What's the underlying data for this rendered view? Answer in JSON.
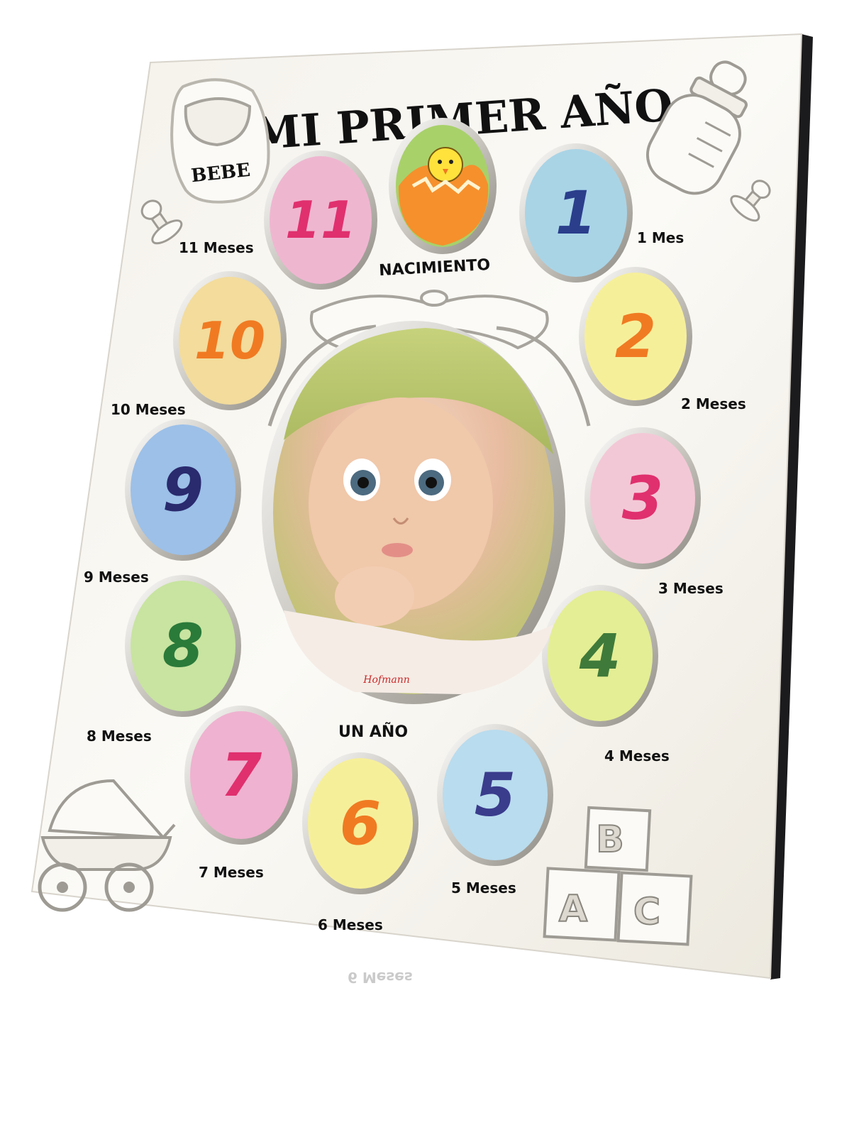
{
  "frame": {
    "title": "MI PRIMER AÑO",
    "bib_text": "BEBE",
    "center_top_label": "NACIMIENTO",
    "center_bottom_label": "UN AÑO",
    "brand": "Hofmann",
    "reflection_text": "6 Meses"
  },
  "months": [
    {
      "number": "1",
      "caption": "1 Mes",
      "bg": "#a9d4e6",
      "fg": "#2a3e8c"
    },
    {
      "number": "2",
      "caption": "2 Meses",
      "bg": "#f6ef9a",
      "fg": "#f07a22"
    },
    {
      "number": "3",
      "caption": "3 Meses",
      "bg": "#f3c8d6",
      "fg": "#e0306e"
    },
    {
      "number": "4",
      "caption": "4 Meses",
      "bg": "#e4ee94",
      "fg": "#3f7a3a"
    },
    {
      "number": "5",
      "caption": "5 Meses",
      "bg": "#b9dcee",
      "fg": "#3a3c8c"
    },
    {
      "number": "6",
      "caption": "6 Meses",
      "bg": "#f6ef9a",
      "fg": "#f07a22"
    },
    {
      "number": "7",
      "caption": "7 Meses",
      "bg": "#efb2d0",
      "fg": "#e0306e"
    },
    {
      "number": "8",
      "caption": "8 Meses",
      "bg": "#c8e4a0",
      "fg": "#2a7a3a"
    },
    {
      "number": "9",
      "caption": "9 Meses",
      "bg": "#9cc0e8",
      "fg": "#2a2a6e"
    },
    {
      "number": "10",
      "caption": "10 Meses",
      "bg": "#f3dc9c",
      "fg": "#f07a22"
    },
    {
      "number": "11",
      "caption": "11 Meses",
      "bg": "#efb6d0",
      "fg": "#e0306e"
    }
  ],
  "icons": {
    "rattle_left": "rattle-icon",
    "rattle_right": "pacifier-icon",
    "bib": "bib-icon",
    "bottle": "baby-bottle-icon",
    "stroller": "stroller-icon",
    "blocks": "abc-blocks-icon",
    "chick": "chick-icon",
    "bow": "bow-icon"
  },
  "block_letters": [
    "B",
    "A",
    "C"
  ]
}
